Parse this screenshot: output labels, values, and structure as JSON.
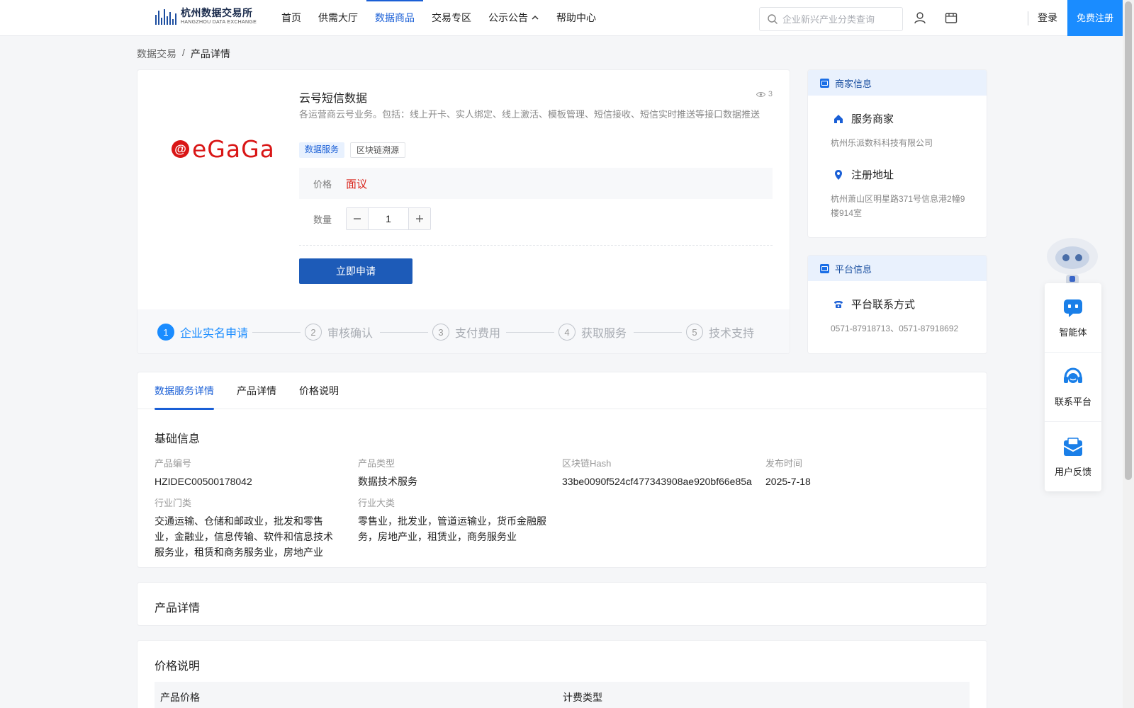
{
  "header": {
    "logo_cn": "杭州数据交易所",
    "logo_en": "HANGZHOU DATA EXCHANGE",
    "nav": [
      "首页",
      "供需大厅",
      "数据商品",
      "交易专区",
      "公示公告",
      "帮助中心"
    ],
    "nav_active_index": 2,
    "search_placeholder": "企业新兴产业分类查询",
    "login": "登录",
    "register": "免费注册"
  },
  "breadcrumb": {
    "root": "数据交易",
    "sep": "/",
    "current": "产品详情"
  },
  "product": {
    "logo_text": "eGaGa",
    "logo_mark": "@",
    "title": "云号短信数据",
    "views": "3",
    "description": "各运营商云号业务。包括：线上开卡、实人绑定、线上激活、模板管理、短信接收、短信实时推送等接口数据推送",
    "tags": [
      "数据服务",
      "区块链溯源"
    ],
    "price_label": "价格",
    "price_value": "面议",
    "qty_label": "数量",
    "qty_value": "1",
    "apply_button": "立即申请",
    "steps": [
      {
        "num": "1",
        "label": "企业实名申请"
      },
      {
        "num": "2",
        "label": "审核确认"
      },
      {
        "num": "3",
        "label": "支付费用"
      },
      {
        "num": "4",
        "label": "获取服务"
      },
      {
        "num": "5",
        "label": "技术支持"
      }
    ],
    "active_step": 0
  },
  "merchant": {
    "head": "商家信息",
    "service_label": "服务商家",
    "service_value": "杭州乐派数科科技有限公司",
    "address_label": "注册地址",
    "address_value": "杭州萧山区明星路371号信息港2幢9楼914室"
  },
  "platform": {
    "head": "平台信息",
    "contact_label": "平台联系方式",
    "contact_value": "0571-87918713、0571-87918692"
  },
  "floating": {
    "items": [
      "智能体",
      "联系平台",
      "用户反馈"
    ]
  },
  "detail": {
    "tabs": [
      "数据服务详情",
      "产品详情",
      "价格说明"
    ],
    "active_tab": 0,
    "section_title": "基础信息",
    "fields": {
      "product_no": {
        "label": "产品编号",
        "value": "HZIDEC00500178042"
      },
      "product_type": {
        "label": "产品类型",
        "value": "数据技术服务"
      },
      "hash": {
        "label": "区块链Hash",
        "value": "33be0090f524cf477343908ae920bf66e85a"
      },
      "publish": {
        "label": "发布时间",
        "value": "2025-7-18"
      },
      "industry_cat": {
        "label": "行业门类",
        "value": "交通运输、仓储和邮政业，批发和零售业，金融业，信息传输、软件和信息技术服务业，租赁和商务服务业，房地产业"
      },
      "industry_major": {
        "label": "行业大类",
        "value": "零售业，批发业，管道运输业，货币金融服务，房地产业，租赁业，商务服务业"
      }
    }
  },
  "product_detail_section": {
    "title": "产品详情"
  },
  "price_section": {
    "title": "价格说明",
    "columns": [
      "产品价格",
      "计费类型"
    ]
  },
  "colors": {
    "accent": "#1a5fd6",
    "register": "#1a8cff",
    "price": "#d9241b",
    "brand_logo": "#d91616"
  }
}
